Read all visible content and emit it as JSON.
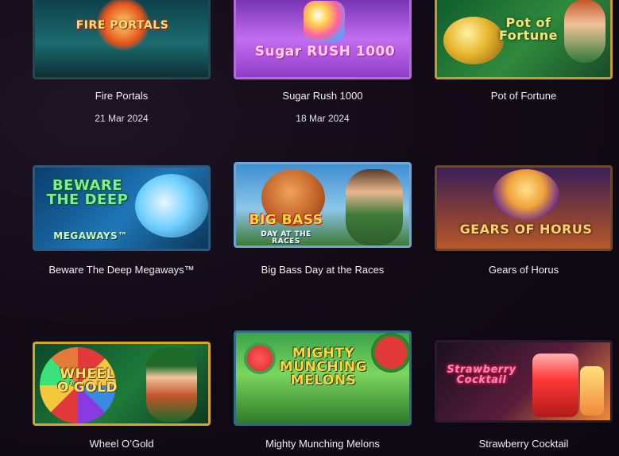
{
  "games": [
    {
      "id": "fire-portals",
      "title": "Fire Portals",
      "logo": "FIRE PORTALS",
      "date": "21 Mar 2024",
      "accent": "#f6a21b",
      "colors": [
        "#0c3a45",
        "#1b6b6f",
        "#e4521b"
      ]
    },
    {
      "id": "sugar-rush",
      "title": "Sugar Rush 1000",
      "logo": "Sugar RUSH 1000",
      "date": "18 Mar 2024",
      "accent": "#ff6fd2",
      "colors": [
        "#6a2aa8",
        "#c36ef0",
        "#ffd34e"
      ]
    },
    {
      "id": "pot-of-fortune",
      "title": "Pot of Fortune",
      "logo": "Pot of Fortune",
      "accent": "#f3c33a",
      "colors": [
        "#0f5b2c",
        "#2f8a3c",
        "#e7b52c"
      ]
    },
    {
      "id": "beware-the-deep",
      "title": "Beware The Deep Megaways™",
      "logo": "BEWARE THE DEEP",
      "sub": "MEGAWAYS™",
      "accent": "#5ee07a",
      "colors": [
        "#0a3d6b",
        "#1f77b8",
        "#6fd0ff"
      ]
    },
    {
      "id": "big-bass",
      "title": "Big Bass Day at the Races",
      "logo": "BIG BASS",
      "sub": "DAY AT THE RACES",
      "accent": "#f43a2a",
      "colors": [
        "#3f8fd1",
        "#8ec6ea",
        "#3c7a35"
      ]
    },
    {
      "id": "gears-of-horus",
      "title": "Gears of Horus",
      "logo": "GEARS OF HORUS",
      "accent": "#f0b43b",
      "colors": [
        "#3a1f5b",
        "#b8582a",
        "#f0a23b"
      ]
    },
    {
      "id": "wheel-o-gold",
      "title": "Wheel O’Gold",
      "logo": "WHEEL O'GOLD",
      "accent": "#f3c83a",
      "colors": [
        "#0b4a2a",
        "#1e7b3a",
        "#e8b22a"
      ]
    },
    {
      "id": "mighty-melons",
      "title": "Mighty Munching Melons",
      "logo": "MIGHTY MUNCHING MELONS",
      "accent": "#f4c52d",
      "colors": [
        "#3aa24a",
        "#7bd65f",
        "#e23a3a"
      ]
    },
    {
      "id": "strawberry-cocktail",
      "title": "Strawberry Cocktail",
      "logo": "Strawberry Cocktail",
      "accent": "#ff3a5c",
      "colors": [
        "#1a1020",
        "#5a1d3a",
        "#f08a3a"
      ]
    }
  ]
}
